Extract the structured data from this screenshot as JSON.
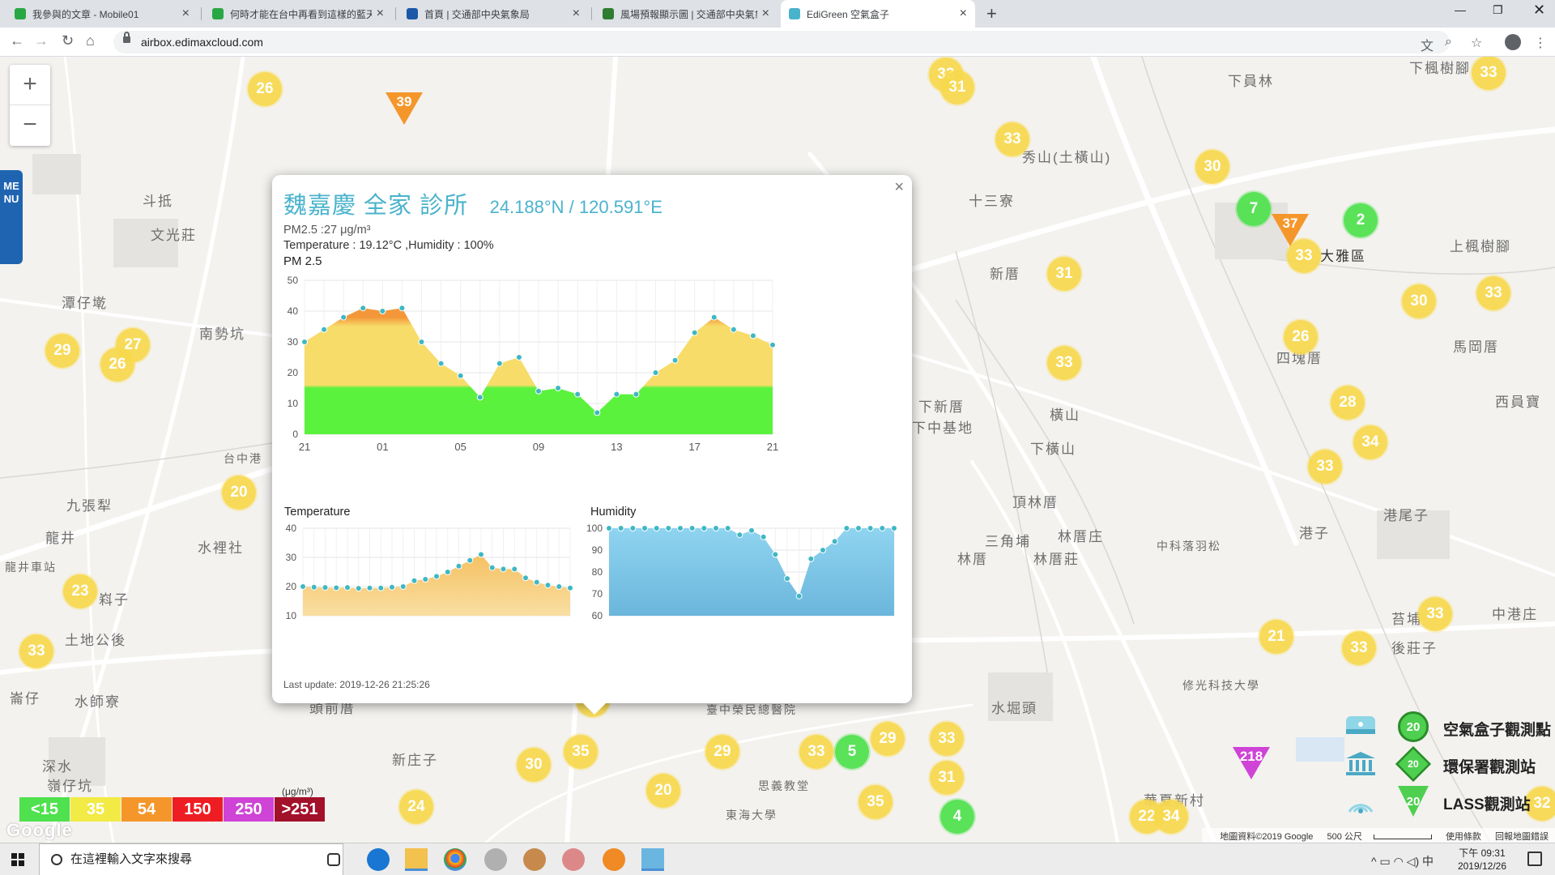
{
  "browser": {
    "tabs": [
      {
        "title": "我參與的文章 - Mobile01",
        "favicon_color": "#29a745"
      },
      {
        "title": "何時才能在台中再看到這樣的藍天",
        "favicon_color": "#29a745"
      },
      {
        "title": "首頁 | 交通部中央氣象局",
        "favicon_color": "#1c58a8"
      },
      {
        "title": "風場預報顯示圖 | 交通部中央氣象",
        "favicon_color": "#2e7d32"
      },
      {
        "title": "EdiGreen 空氣盒子",
        "favicon_color": "#4ab3cc"
      }
    ],
    "active_tab": 4,
    "url": "airbox.edimaxcloud.com"
  },
  "map": {
    "zoom_in": "+",
    "zoom_out": "−",
    "menu_label": "MENU",
    "places": [
      "下員林",
      "下楓樹腳",
      "秀山(土橫山)",
      "十三寮",
      "斗抵",
      "文光莊",
      "潭仔墘",
      "南勢坑",
      "新厝",
      "大雅區",
      "上楓樹腳",
      "馬岡厝",
      "四塊厝",
      "下新厝",
      "下中基地",
      "橫山",
      "下橫山",
      "頂林厝",
      "三角埔",
      "林厝庄",
      "林厝",
      "林厝莊",
      "九張犁",
      "水裡社",
      "龍井",
      "土地公後",
      "水師寮",
      "頭前厝",
      "新庄子",
      "深水",
      "嶺仔坑",
      "港子",
      "港尾子",
      "西員寶",
      "苔埔",
      "後莊子",
      "中港庄",
      "水堀頭",
      "中科落羽松",
      "台中港",
      "橫山",
      "龍井車站",
      "嵙子",
      "崙仔",
      "臺中榮民總醫院",
      "東海大學",
      "思義教堂",
      "修光科技大學",
      "華夏新村",
      "西員",
      "萬"
    ],
    "markers": [
      {
        "v": "26",
        "c": "yellow"
      },
      {
        "v": "33",
        "c": "yellow"
      },
      {
        "v": "31",
        "c": "yellow"
      },
      {
        "v": "33",
        "c": "yellow"
      },
      {
        "v": "33",
        "c": "yellow"
      },
      {
        "v": "30",
        "c": "yellow"
      },
      {
        "v": "7",
        "c": "green"
      },
      {
        "v": "2",
        "c": "green"
      },
      {
        "v": "33",
        "c": "yellow"
      },
      {
        "v": "31",
        "c": "yellow"
      },
      {
        "v": "30",
        "c": "yellow"
      },
      {
        "v": "33",
        "c": "yellow"
      },
      {
        "v": "26",
        "c": "yellow"
      },
      {
        "v": "33",
        "c": "yellow"
      },
      {
        "v": "28",
        "c": "yellow"
      },
      {
        "v": "34",
        "c": "yellow"
      },
      {
        "v": "33",
        "c": "yellow"
      },
      {
        "v": "29",
        "c": "yellow"
      },
      {
        "v": "27",
        "c": "yellow"
      },
      {
        "v": "26",
        "c": "yellow"
      },
      {
        "v": "20",
        "c": "yellow"
      },
      {
        "v": "23",
        "c": "yellow"
      },
      {
        "v": "33",
        "c": "yellow"
      },
      {
        "v": "29",
        "c": "yellow"
      },
      {
        "v": "32",
        "c": "yellow"
      },
      {
        "v": "31",
        "c": "yellow"
      },
      {
        "v": "27",
        "c": "yellow"
      },
      {
        "v": "35",
        "c": "yellow"
      },
      {
        "v": "30",
        "c": "yellow"
      },
      {
        "v": "29",
        "c": "yellow"
      },
      {
        "v": "33",
        "c": "yellow"
      },
      {
        "v": "5",
        "c": "green"
      },
      {
        "v": "29",
        "c": "yellow"
      },
      {
        "v": "33",
        "c": "yellow"
      },
      {
        "v": "31",
        "c": "yellow"
      },
      {
        "v": "20",
        "c": "yellow"
      },
      {
        "v": "35",
        "c": "yellow"
      },
      {
        "v": "4",
        "c": "green"
      },
      {
        "v": "24",
        "c": "yellow"
      },
      {
        "v": "21",
        "c": "yellow"
      },
      {
        "v": "33",
        "c": "yellow"
      },
      {
        "v": "33",
        "c": "yellow"
      },
      {
        "v": "22",
        "c": "yellow"
      },
      {
        "v": "34",
        "c": "yellow"
      },
      {
        "v": "32",
        "c": "yellow"
      }
    ],
    "triangles": [
      {
        "v": "39",
        "c": "orange"
      },
      {
        "v": "37",
        "c": "orange"
      },
      {
        "v": "218",
        "c": "purple"
      }
    ],
    "attribution": "地圖資料©2019 Google",
    "scale": "500 公尺",
    "terms": "使用條款",
    "report": "回報地圖錯誤",
    "logo": "Google"
  },
  "popup": {
    "name": "魏嘉慶 全家 診所",
    "coords": "24.188°N / 120.591°E",
    "pm_line": "PM2.5 :27 μg/m³",
    "temp_line": "Temperature : 19.12°C ,Humidity : 100%",
    "pm_title": "PM 2.5",
    "temp_title": "Temperature",
    "hum_title": "Humidity",
    "last_update": "Last update: 2019-12-26 21:25:26",
    "close": "×"
  },
  "legend": {
    "items": [
      {
        "sym": "20",
        "label": "空氣盒子觀測點"
      },
      {
        "sym": "20",
        "label": "環保署觀測站"
      },
      {
        "sym": "20",
        "label": "LASS觀測站"
      }
    ]
  },
  "scale_bar": {
    "unit": "(μg/m³)",
    "levels": [
      {
        "label": "<15",
        "color": "#4fe14e"
      },
      {
        "label": "35",
        "color": "#f2ea45"
      },
      {
        "label": "54",
        "color": "#f5962b"
      },
      {
        "label": "150",
        "color": "#ee1d23"
      },
      {
        "label": "250",
        "color": "#cf43d6"
      },
      {
        "label": ">251",
        "color": "#a3102a"
      }
    ]
  },
  "taskbar": {
    "search_placeholder": "在這裡輸入文字來搜尋",
    "time": "下午 09:31",
    "date": "2019/12/26",
    "ime": "中"
  },
  "chart_data": [
    {
      "type": "area",
      "title": "PM 2.5",
      "x_ticks": [
        "21",
        "01",
        "05",
        "09",
        "13",
        "17",
        "21"
      ],
      "ylim": [
        0,
        50
      ],
      "y_ticks": [
        0,
        10,
        20,
        30,
        40,
        50
      ],
      "values": [
        30,
        34,
        38,
        41,
        40,
        41,
        30,
        23,
        19,
        12,
        23,
        25,
        14,
        15,
        13,
        7,
        13,
        13,
        20,
        24,
        33,
        38,
        34,
        32,
        29
      ],
      "thresholds": [
        {
          "value": 15,
          "color": "#5bf23d"
        },
        {
          "value": 35,
          "color": "#f7dc6a"
        },
        {
          "value": 54,
          "color": "#f5962b"
        }
      ],
      "grid": true
    },
    {
      "type": "area",
      "title": "Temperature",
      "ylim": [
        10,
        40
      ],
      "y_ticks": [
        10,
        20,
        30,
        40
      ],
      "values": [
        20,
        19.8,
        19.7,
        19.6,
        19.7,
        19.4,
        19.5,
        19.5,
        19.8,
        20,
        22,
        22.5,
        23.5,
        25,
        27,
        29,
        31,
        26.5,
        26,
        26,
        23,
        21.5,
        20.5,
        20,
        19.5
      ],
      "color": "#f7d27e",
      "grid": true
    },
    {
      "type": "area",
      "title": "Humidity",
      "ylim": [
        60,
        100
      ],
      "y_ticks": [
        60,
        70,
        80,
        90,
        100
      ],
      "values": [
        100,
        100,
        100,
        100,
        100,
        100,
        100,
        100,
        100,
        100,
        100,
        97,
        99,
        96,
        88,
        77,
        69,
        86,
        90,
        94,
        100,
        100,
        100,
        100,
        100
      ],
      "color": "#7ccbe8",
      "grid": true
    }
  ]
}
